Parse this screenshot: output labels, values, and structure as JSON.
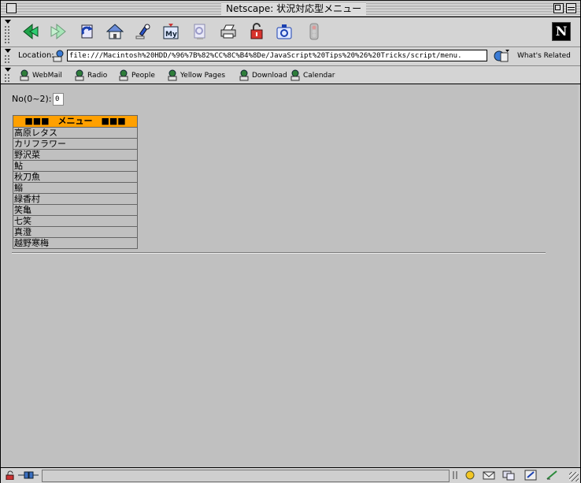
{
  "window": {
    "title": "Netscape: 状況対応型メニュー"
  },
  "toolbar": {
    "buttons": [
      "back-icon",
      "forward-icon",
      "reload-icon",
      "home-icon",
      "search-icon",
      "my-netscape-icon",
      "images-icon",
      "print-icon",
      "security-icon",
      "shop-icon",
      "stop-icon"
    ]
  },
  "location": {
    "label": "Location:",
    "url": "file:///Macintosh%20HDD/%96%7B%82%CC%8C%B4%8De/JavaScript%20Tips%20%26%20Tricks/script/menu.",
    "related_label": "What's Related"
  },
  "personal_toolbar": {
    "items": [
      "WebMail",
      "Radio",
      "People",
      "Yellow Pages",
      "Download",
      "Calendar"
    ]
  },
  "page": {
    "no_label": "No(0~2):",
    "no_value": "0",
    "menu_header": "■■■　メニュー　■■■",
    "menu_items": [
      "高原レタス",
      "カリフラワー",
      "野沢菜",
      "鮎",
      "秋刀魚",
      "鰯",
      "緑香村",
      "笑亀",
      "七笑",
      "真澄",
      "越野寒梅"
    ]
  },
  "colors": {
    "menu_header_bg": "#ffa000",
    "content_bg": "#c0c0c0"
  },
  "status": {
    "text": ""
  }
}
